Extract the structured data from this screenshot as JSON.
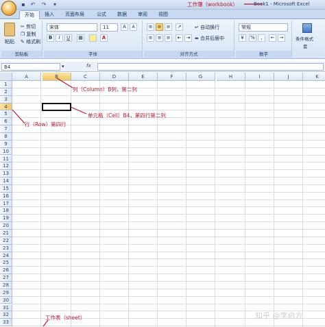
{
  "window": {
    "title": "Book1 - Microsoft Excel"
  },
  "quick_access": {
    "save_icon": "save-icon",
    "undo": "↶",
    "redo": "↷",
    "customize": "▾"
  },
  "tabs": [
    {
      "label": "开始",
      "active": true
    },
    {
      "label": "插入",
      "active": false
    },
    {
      "label": "页面布局",
      "active": false
    },
    {
      "label": "公式",
      "active": false
    },
    {
      "label": "数据",
      "active": false
    },
    {
      "label": "审阅",
      "active": false
    },
    {
      "label": "视图",
      "active": false
    }
  ],
  "ribbon": {
    "clipboard": {
      "paste": "粘贴",
      "cut": "剪切",
      "copy": "复制",
      "format_painter": "格式刷",
      "label": "剪贴板"
    },
    "font": {
      "name": "宋体",
      "size": "11",
      "grow": "A",
      "shrink": "A",
      "bold": "B",
      "italic": "I",
      "underline": "U",
      "label": "字体"
    },
    "alignment": {
      "wrap_text": "自动换行",
      "merge_center": "合并后居中",
      "label": "对齐方式"
    },
    "number": {
      "format": "常规",
      "percent": "%",
      "comma": ",",
      "label": "数字"
    },
    "styles": {
      "conditional_format": "条件格式",
      "table_format": "套"
    }
  },
  "formula_bar": {
    "cell_ref": "B4",
    "fx": "fx",
    "value": ""
  },
  "sheet": {
    "columns": [
      "A",
      "B",
      "C",
      "D",
      "E",
      "F",
      "G",
      "H",
      "I",
      "J",
      "K"
    ],
    "rows": [
      "1",
      "2",
      "3",
      "4",
      "5",
      "6",
      "7",
      "8",
      "9",
      "10",
      "11",
      "12",
      "13",
      "14",
      "15",
      "16",
      "17",
      "18",
      "19",
      "20",
      "21",
      "22",
      "23",
      "24",
      "25",
      "26",
      "27",
      "28",
      "29",
      "30",
      "31",
      "32",
      "33"
    ],
    "selected_column": "B",
    "selected_row": "4"
  },
  "annotations": {
    "workbook": "工作薄（workbook）",
    "column": "列（Column）B列，第二列",
    "cell": "单元格（Cell）B4，第四行第二列",
    "row": "行（Row）第四行",
    "sheet": "工作表（sheet）",
    "color": "#c0142c"
  },
  "watermark": "知乎 @李启方"
}
